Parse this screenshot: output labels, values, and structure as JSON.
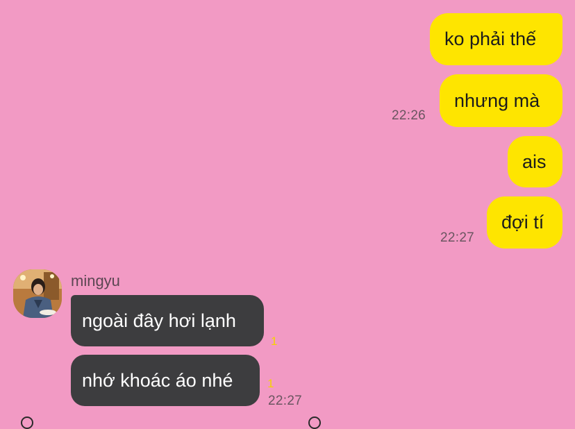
{
  "messages_out": [
    {
      "text": "ko phải thế"
    },
    {
      "text": "nhưng mà",
      "time": "22:26"
    },
    {
      "text": "ais"
    },
    {
      "text": "đợi tí",
      "time": "22:27"
    }
  ],
  "incoming": {
    "sender": "mingyu",
    "avatar_icon": "profile-photo",
    "messages": [
      {
        "text": "ngoài đây hơi lạnh",
        "unread": "1"
      },
      {
        "text": "nhớ khoác áo nhé",
        "unread": "1",
        "time": "22:27"
      }
    ]
  },
  "colors": {
    "background": "#f29ac4",
    "my_bubble": "#fee500",
    "their_bubble": "#3d3d3f",
    "unread_count": "#f5d300"
  }
}
